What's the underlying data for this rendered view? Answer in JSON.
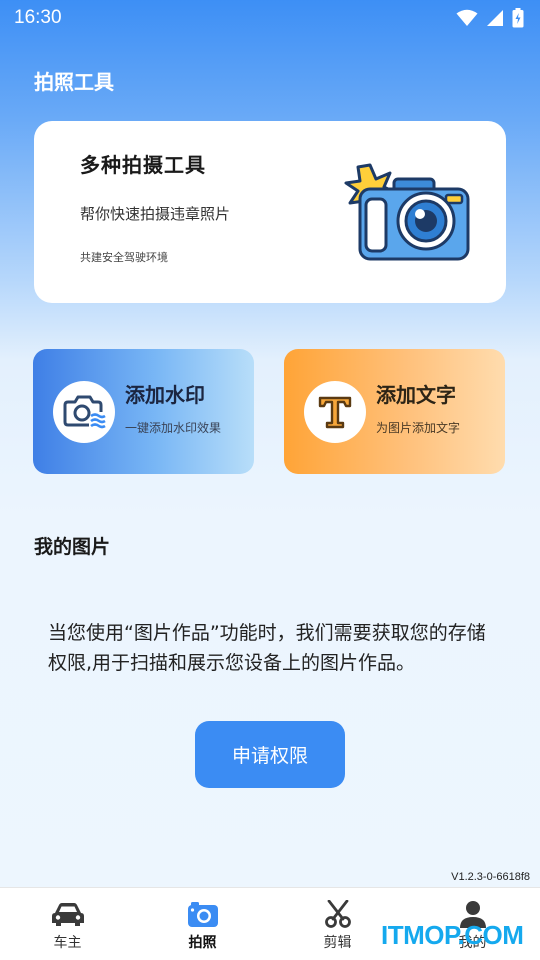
{
  "status_bar": {
    "time": "16:30"
  },
  "header": {
    "title": "拍照工具"
  },
  "hero": {
    "title": "多种拍摄工具",
    "subtitle": "帮你快速拍摄违章照片",
    "note": "共建安全驾驶环境",
    "icon": "camera-icon"
  },
  "tools": [
    {
      "title": "添加水印",
      "desc": "一键添加水印效果",
      "icon": "watermark-camera-icon",
      "color": "#3f7fe6"
    },
    {
      "title": "添加文字",
      "desc": "为图片添加文字",
      "icon": "text-t-icon",
      "color": "#ffa437"
    }
  ],
  "my_pictures": {
    "title": "我的图片",
    "permission_message": "当您使用“图片作品”功能时，我们需要获取您的存储权限,用于扫描和展示您设备上的图片作品。",
    "permission_button": "申请权限"
  },
  "version": "V1.2.3-0-6618f8",
  "tabs": [
    {
      "label": "车主",
      "icon": "car-icon",
      "active": false
    },
    {
      "label": "拍照",
      "icon": "camera-icon",
      "active": true
    },
    {
      "label": "剪辑",
      "icon": "scissors-icon",
      "active": false
    },
    {
      "label": "我的",
      "icon": "user-icon",
      "active": false
    }
  ],
  "overlay": {
    "text": "ITMOP.COM"
  },
  "colors": {
    "accent": "#3b8cf3",
    "tab_active": "#3b8cf3"
  }
}
